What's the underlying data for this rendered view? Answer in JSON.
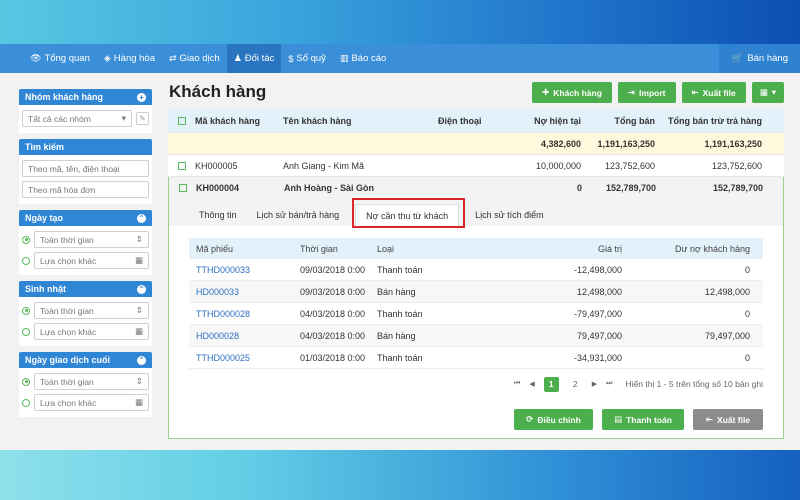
{
  "nav": {
    "items": [
      {
        "label": "Tổng quan",
        "icon": "eye-icon"
      },
      {
        "label": "Hàng hóa",
        "icon": "cube-icon"
      },
      {
        "label": "Giao dịch",
        "icon": "exchange-icon"
      },
      {
        "label": "Đối tác",
        "icon": "person-icon"
      },
      {
        "label": "Sổ quỹ",
        "icon": "dollar-icon"
      },
      {
        "label": "Báo cáo",
        "icon": "bar-chart-icon"
      }
    ],
    "active_index": 3,
    "sell_label": "Bán hàng"
  },
  "sidebar": {
    "group": {
      "title": "Nhóm khách hàng",
      "select": "Tất cả các nhóm"
    },
    "search": {
      "title": "Tìm kiếm",
      "placeholder1": "Theo mã, tên, điện thoại",
      "placeholder2": "Theo mã hóa đơn"
    },
    "created": {
      "title": "Ngày tạo",
      "opt1": "Toàn thời gian",
      "opt2": "Lựa chọn khác"
    },
    "birthday": {
      "title": "Sinh nhật",
      "opt1": "Toàn thời gian",
      "opt2": "Lựa chọn khác"
    },
    "last_txn": {
      "title": "Ngày giao dịch cuối",
      "opt1": "Toàn thời gian",
      "opt2": "Lựa chọn khác"
    }
  },
  "page": {
    "title": "Khách hàng",
    "add_label": "Khách hàng",
    "import_label": "Import",
    "export_label": "Xuất file"
  },
  "grid": {
    "headers": [
      "Mã khách hàng",
      "Tên khách hàng",
      "Điện thoại",
      "Nợ hiện tại",
      "Tổng bán",
      "Tổng bán trừ trả hàng"
    ],
    "summary": {
      "debt": "4,382,600",
      "total": "1,191,163,250",
      "net": "1,191,163,250"
    },
    "rows": [
      {
        "code": "KH000005",
        "name": "Anh Giang - Kim Mã",
        "phone": "",
        "debt": "10,000,000",
        "total": "123,752,600",
        "net": "123,752,600"
      }
    ],
    "selected": {
      "code": "KH000004",
      "name": "Anh Hoàng - Sài Gòn",
      "phone": "",
      "debt": "0",
      "total": "152,789,700",
      "net": "152,789,700"
    }
  },
  "detail": {
    "tabs": [
      "Thông tin",
      "Lịch sử bán/trả hàng",
      "Nợ cần thu từ khách",
      "Lịch sử tích điểm"
    ],
    "active_tab": 2,
    "headers": [
      "Mã phiếu",
      "Thời gian",
      "Loại",
      "Giá trị",
      "Dư nợ khách hàng"
    ],
    "rows": [
      {
        "code": "TTHD000033",
        "time": "09/03/2018 0:00",
        "type": "Thanh toán",
        "value": "-12,498,000",
        "balance": "0"
      },
      {
        "code": "HD000033",
        "time": "09/03/2018 0:00",
        "type": "Bán hàng",
        "value": "12,498,000",
        "balance": "12,498,000"
      },
      {
        "code": "TTHD000028",
        "time": "04/03/2018 0:00",
        "type": "Thanh toán",
        "value": "-79,497,000",
        "balance": "0"
      },
      {
        "code": "HD000028",
        "time": "04/03/2018 0:00",
        "type": "Bán hàng",
        "value": "79,497,000",
        "balance": "79,497,000"
      },
      {
        "code": "TTHD000025",
        "time": "01/03/2018 0:00",
        "type": "Thanh toán",
        "value": "-34,931,000",
        "balance": "0"
      }
    ],
    "pager": {
      "pages": [
        "1",
        "2"
      ],
      "current": "1",
      "info": "Hiển thị 1 - 5 trên tổng số 10 bản ghi"
    },
    "adjust_label": "Điều chỉnh",
    "pay_label": "Thanh toán",
    "export_label": "Xuất file"
  },
  "colors": {
    "nav": "#3b8fd8",
    "accent_green": "#4cae4c",
    "highlight_red": "#d9262b",
    "link": "#2e6fc1"
  }
}
